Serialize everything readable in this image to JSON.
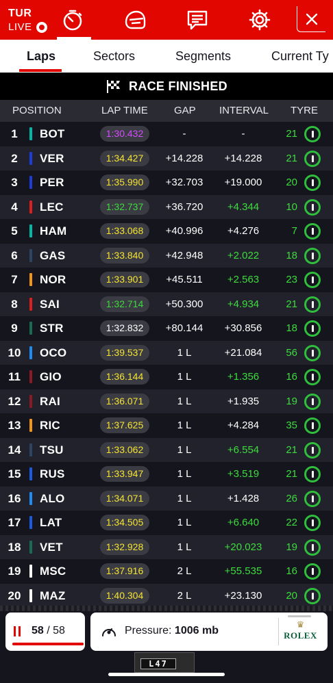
{
  "header": {
    "race_code": "TUR",
    "live_label": "LIVE",
    "nav_icons": [
      "timer-icon",
      "helmet-icon",
      "chat-icon",
      "gear-icon"
    ],
    "close_icon": "close-icon",
    "accent_color": "#e10600"
  },
  "tabs": [
    {
      "label": "Laps",
      "active": true
    },
    {
      "label": "Sectors",
      "active": false
    },
    {
      "label": "Segments",
      "active": false
    },
    {
      "label": "Current Ty",
      "active": false
    }
  ],
  "banner": {
    "icon": "checkered-flag-icon",
    "text": "RACE FINISHED"
  },
  "table": {
    "columns": {
      "position": "POSITION",
      "lap_time": "LAP TIME",
      "gap": "GAP",
      "interval": "INTERVAL",
      "tyre": "TYRE"
    },
    "rows": [
      {
        "pos": "1",
        "code": "BOT",
        "team_color": "#00b8a9",
        "lap_time": "1:30.432",
        "lap_color": "purple",
        "gap": "-",
        "interval": "-",
        "interval_color": "white",
        "laps": "21",
        "tyre": "intermediate"
      },
      {
        "pos": "2",
        "code": "VER",
        "team_color": "#1e3cd6",
        "lap_time": "1:34.427",
        "lap_color": "yellow",
        "gap": "+14.228",
        "interval": "+14.228",
        "interval_color": "white",
        "laps": "21",
        "tyre": "intermediate"
      },
      {
        "pos": "3",
        "code": "PER",
        "team_color": "#1e3cd6",
        "lap_time": "1:35.990",
        "lap_color": "yellow",
        "gap": "+32.703",
        "interval": "+19.000",
        "interval_color": "white",
        "laps": "20",
        "tyre": "intermediate"
      },
      {
        "pos": "4",
        "code": "LEC",
        "team_color": "#dc1e1e",
        "lap_time": "1:32.737",
        "lap_color": "green",
        "gap": "+36.720",
        "interval": "+4.344",
        "interval_color": "green",
        "laps": "10",
        "tyre": "intermediate"
      },
      {
        "pos": "5",
        "code": "HAM",
        "team_color": "#00b8a9",
        "lap_time": "1:33.068",
        "lap_color": "yellow",
        "gap": "+40.996",
        "interval": "+4.276",
        "interval_color": "white",
        "laps": "7",
        "tyre": "intermediate"
      },
      {
        "pos": "6",
        "code": "GAS",
        "team_color": "#2b4562",
        "lap_time": "1:33.840",
        "lap_color": "yellow",
        "gap": "+42.948",
        "interval": "+2.022",
        "interval_color": "green",
        "laps": "18",
        "tyre": "intermediate"
      },
      {
        "pos": "7",
        "code": "NOR",
        "team_color": "#f29417",
        "lap_time": "1:33.901",
        "lap_color": "yellow",
        "gap": "+45.511",
        "interval": "+2.563",
        "interval_color": "green",
        "laps": "23",
        "tyre": "intermediate"
      },
      {
        "pos": "8",
        "code": "SAI",
        "team_color": "#dc1e1e",
        "lap_time": "1:32.714",
        "lap_color": "green",
        "gap": "+50.300",
        "interval": "+4.934",
        "interval_color": "green",
        "laps": "21",
        "tyre": "intermediate"
      },
      {
        "pos": "9",
        "code": "STR",
        "team_color": "#1a6b54",
        "lap_time": "1:32.832",
        "lap_color": "white",
        "gap": "+80.144",
        "interval": "+30.856",
        "interval_color": "white",
        "laps": "18",
        "tyre": "intermediate"
      },
      {
        "pos": "10",
        "code": "OCO",
        "team_color": "#1d8ef0",
        "lap_time": "1:39.537",
        "lap_color": "yellow",
        "gap": "1 L",
        "interval": "+21.084",
        "interval_color": "white",
        "laps": "56",
        "tyre": "intermediate"
      },
      {
        "pos": "11",
        "code": "GIO",
        "team_color": "#8c1a22",
        "lap_time": "1:36.144",
        "lap_color": "yellow",
        "gap": "1 L",
        "interval": "+1.356",
        "interval_color": "green",
        "laps": "16",
        "tyre": "intermediate"
      },
      {
        "pos": "12",
        "code": "RAI",
        "team_color": "#8c1a22",
        "lap_time": "1:36.071",
        "lap_color": "yellow",
        "gap": "1 L",
        "interval": "+1.935",
        "interval_color": "white",
        "laps": "19",
        "tyre": "intermediate"
      },
      {
        "pos": "13",
        "code": "RIC",
        "team_color": "#f29417",
        "lap_time": "1:37.625",
        "lap_color": "yellow",
        "gap": "1 L",
        "interval": "+4.284",
        "interval_color": "white",
        "laps": "35",
        "tyre": "intermediate"
      },
      {
        "pos": "14",
        "code": "TSU",
        "team_color": "#2b4562",
        "lap_time": "1:33.062",
        "lap_color": "yellow",
        "gap": "1 L",
        "interval": "+6.554",
        "interval_color": "green",
        "laps": "21",
        "tyre": "intermediate"
      },
      {
        "pos": "15",
        "code": "RUS",
        "team_color": "#1a5be0",
        "lap_time": "1:33.947",
        "lap_color": "yellow",
        "gap": "1 L",
        "interval": "+3.519",
        "interval_color": "green",
        "laps": "21",
        "tyre": "intermediate"
      },
      {
        "pos": "16",
        "code": "ALO",
        "team_color": "#1d8ef0",
        "lap_time": "1:34.071",
        "lap_color": "yellow",
        "gap": "1 L",
        "interval": "+1.428",
        "interval_color": "white",
        "laps": "26",
        "tyre": "intermediate"
      },
      {
        "pos": "17",
        "code": "LAT",
        "team_color": "#1a5be0",
        "lap_time": "1:34.505",
        "lap_color": "yellow",
        "gap": "1 L",
        "interval": "+6.640",
        "interval_color": "green",
        "laps": "22",
        "tyre": "intermediate"
      },
      {
        "pos": "18",
        "code": "VET",
        "team_color": "#1a6b54",
        "lap_time": "1:32.928",
        "lap_color": "yellow",
        "gap": "1 L",
        "interval": "+20.023",
        "interval_color": "green",
        "laps": "19",
        "tyre": "intermediate"
      },
      {
        "pos": "19",
        "code": "MSC",
        "team_color": "#ffffff",
        "lap_time": "1:37.916",
        "lap_color": "yellow",
        "gap": "2 L",
        "interval": "+55.535",
        "interval_color": "green",
        "laps": "16",
        "tyre": "intermediate"
      },
      {
        "pos": "20",
        "code": "MAZ",
        "team_color": "#ffffff",
        "lap_time": "1:40.304",
        "lap_color": "yellow",
        "gap": "2 L",
        "interval": "+23.130",
        "interval_color": "white",
        "laps": "20",
        "tyre": "intermediate"
      }
    ]
  },
  "footer": {
    "current_lap": "58",
    "lap_separator": "/",
    "total_laps": "58",
    "progress_fraction": 1.0,
    "pressure_label": "Pressure:",
    "pressure_value": "1006 mb",
    "sponsor": "ROLEX",
    "car_plate": "L47"
  }
}
